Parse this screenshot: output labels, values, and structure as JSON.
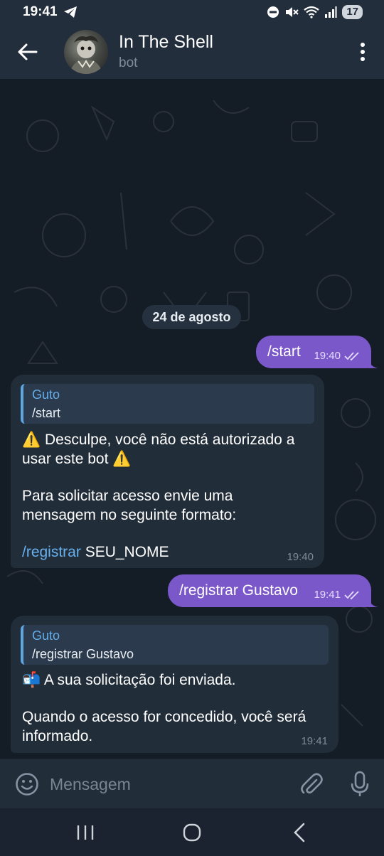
{
  "status_bar": {
    "time": "19:41",
    "battery": "17"
  },
  "header": {
    "title": "In The Shell",
    "subtitle": "bot"
  },
  "chat": {
    "date": "24 de agosto",
    "messages": [
      {
        "direction": "out",
        "text": "/start",
        "time": "19:40",
        "status": "read"
      },
      {
        "direction": "in",
        "reply_author": "Guto",
        "reply_text": "/start",
        "line1": "⚠️ Desculpe, você não está autorizado a",
        "line2": "usar este bot ⚠️",
        "line3": "Para solicitar acesso envie uma",
        "line4": "mensagem no seguinte formato:",
        "cmd": "/registrar",
        "cmd_rest": " SEU_NOME",
        "time": "19:40"
      },
      {
        "direction": "out",
        "text": "/registrar Gustavo",
        "time": "19:41",
        "status": "read"
      },
      {
        "direction": "in",
        "reply_author": "Guto",
        "reply_text": "/registrar Gustavo",
        "line1": "📬 A sua solicitação foi enviada.",
        "line2": "Quando o acesso for concedido, você será",
        "line3": "informado.",
        "time": "19:41"
      }
    ]
  },
  "input": {
    "placeholder": "Mensagem"
  },
  "colors": {
    "outgoing_bubble": "#7b58c9",
    "incoming_bubble": "#222d3a",
    "accent_link": "#68b1ef",
    "header_bg": "#232e3c"
  },
  "icons": [
    "telegram-icon",
    "dnd-icon",
    "mute-icon",
    "wifi-icon",
    "signal-icon",
    "back-arrow-icon",
    "more-vertical-icon",
    "double-check-icon",
    "emoji-icon",
    "paperclip-icon",
    "microphone-icon",
    "recent-apps-icon",
    "home-icon",
    "nav-back-icon"
  ]
}
